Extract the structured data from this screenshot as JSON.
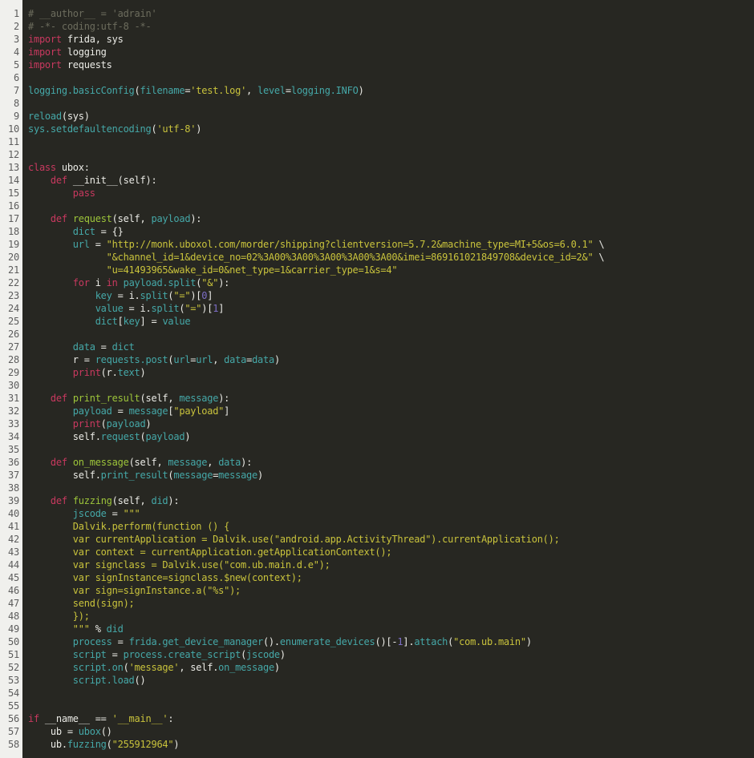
{
  "app": {
    "type": "code-viewer",
    "language": "python"
  },
  "colors": {
    "background": "#272722",
    "gutter_bg": "#f0f0ed",
    "gutter_text": "#5c5c5c",
    "default": "#ebebe6",
    "comment": "#6c6c5d",
    "keyword": "#c8395f",
    "string": "#c9c33c",
    "name": "#45a8a8",
    "function": "#9dc53a",
    "number": "#7d6ec6"
  },
  "editor": {
    "line_count": 58,
    "lines": [
      {
        "n": 1,
        "seg": [
          [
            "c",
            "# __author__ = 'adrain'"
          ]
        ]
      },
      {
        "n": 2,
        "seg": [
          [
            "c",
            "# -*- coding:utf-8 -*-"
          ]
        ]
      },
      {
        "n": 3,
        "seg": [
          [
            "k",
            "import"
          ],
          [
            "d",
            " frida, sys"
          ]
        ]
      },
      {
        "n": 4,
        "seg": [
          [
            "k",
            "import"
          ],
          [
            "d",
            " logging"
          ]
        ]
      },
      {
        "n": 5,
        "seg": [
          [
            "k",
            "import"
          ],
          [
            "d",
            " requests"
          ]
        ]
      },
      {
        "n": 6,
        "seg": []
      },
      {
        "n": 7,
        "seg": [
          [
            "n",
            "logging.basicConfig"
          ],
          [
            "d",
            "("
          ],
          [
            "n",
            "filename"
          ],
          [
            "d",
            "="
          ],
          [
            "s",
            "'test.log'"
          ],
          [
            "d",
            ", "
          ],
          [
            "n",
            "level"
          ],
          [
            "d",
            "="
          ],
          [
            "n",
            "logging.INFO"
          ],
          [
            "d",
            ")"
          ]
        ]
      },
      {
        "n": 8,
        "seg": []
      },
      {
        "n": 9,
        "seg": [
          [
            "n",
            "reload"
          ],
          [
            "d",
            "(sys)"
          ]
        ]
      },
      {
        "n": 10,
        "seg": [
          [
            "n",
            "sys.setdefaultencoding"
          ],
          [
            "d",
            "("
          ],
          [
            "s",
            "'utf-8'"
          ],
          [
            "d",
            ")"
          ]
        ]
      },
      {
        "n": 11,
        "seg": []
      },
      {
        "n": 12,
        "seg": []
      },
      {
        "n": 13,
        "seg": [
          [
            "k",
            "class"
          ],
          [
            "d",
            " ubox:"
          ]
        ]
      },
      {
        "n": 14,
        "seg": [
          [
            "d",
            "    "
          ],
          [
            "k",
            "def"
          ],
          [
            "d",
            " __init__(self):"
          ]
        ]
      },
      {
        "n": 15,
        "seg": [
          [
            "d",
            "        "
          ],
          [
            "k",
            "pass"
          ]
        ]
      },
      {
        "n": 16,
        "seg": []
      },
      {
        "n": 17,
        "seg": [
          [
            "d",
            "    "
          ],
          [
            "k",
            "def"
          ],
          [
            "d",
            " "
          ],
          [
            "f",
            "request"
          ],
          [
            "d",
            "(self, "
          ],
          [
            "n",
            "payload"
          ],
          [
            "d",
            "):"
          ]
        ]
      },
      {
        "n": 18,
        "seg": [
          [
            "d",
            "        "
          ],
          [
            "n",
            "dict"
          ],
          [
            "d",
            " = {}"
          ]
        ]
      },
      {
        "n": 19,
        "seg": [
          [
            "d",
            "        "
          ],
          [
            "n",
            "url"
          ],
          [
            "d",
            " = "
          ],
          [
            "s",
            "\"http://monk.uboxol.com/morder/shipping?clientversion=5.7.2&machine_type=MI+5&os=6.0.1\""
          ],
          [
            "d",
            " \\"
          ]
        ]
      },
      {
        "n": 20,
        "seg": [
          [
            "d",
            "              "
          ],
          [
            "s",
            "\"&channel_id=1&device_no=02%3A00%3A00%3A00%3A00%3A00&imei=869161021849708&device_id=2&\""
          ],
          [
            "d",
            " \\"
          ]
        ]
      },
      {
        "n": 21,
        "seg": [
          [
            "d",
            "              "
          ],
          [
            "s",
            "\"u=41493965&wake_id=0&net_type=1&carrier_type=1&s=4\""
          ]
        ]
      },
      {
        "n": 22,
        "seg": [
          [
            "d",
            "        "
          ],
          [
            "k",
            "for"
          ],
          [
            "d",
            " i "
          ],
          [
            "k",
            "in"
          ],
          [
            "d",
            " "
          ],
          [
            "n",
            "payload.split"
          ],
          [
            "d",
            "("
          ],
          [
            "s",
            "\"&\""
          ],
          [
            "d",
            "):"
          ]
        ]
      },
      {
        "n": 23,
        "seg": [
          [
            "d",
            "            "
          ],
          [
            "n",
            "key"
          ],
          [
            "d",
            " = i."
          ],
          [
            "n",
            "split"
          ],
          [
            "d",
            "("
          ],
          [
            "s",
            "\"=\""
          ],
          [
            "d",
            ")["
          ],
          [
            "m",
            "0"
          ],
          [
            "d",
            "]"
          ]
        ]
      },
      {
        "n": 24,
        "seg": [
          [
            "d",
            "            "
          ],
          [
            "n",
            "value"
          ],
          [
            "d",
            " = i."
          ],
          [
            "n",
            "split"
          ],
          [
            "d",
            "("
          ],
          [
            "s",
            "\"=\""
          ],
          [
            "d",
            ")["
          ],
          [
            "m",
            "1"
          ],
          [
            "d",
            "]"
          ]
        ]
      },
      {
        "n": 25,
        "seg": [
          [
            "d",
            "            "
          ],
          [
            "n",
            "dict"
          ],
          [
            "d",
            "["
          ],
          [
            "n",
            "key"
          ],
          [
            "d",
            "] = "
          ],
          [
            "n",
            "value"
          ]
        ]
      },
      {
        "n": 26,
        "seg": []
      },
      {
        "n": 27,
        "seg": [
          [
            "d",
            "        "
          ],
          [
            "n",
            "data"
          ],
          [
            "d",
            " = "
          ],
          [
            "n",
            "dict"
          ]
        ]
      },
      {
        "n": 28,
        "seg": [
          [
            "d",
            "        r = "
          ],
          [
            "n",
            "requests.post"
          ],
          [
            "d",
            "("
          ],
          [
            "n",
            "url"
          ],
          [
            "d",
            "="
          ],
          [
            "n",
            "url"
          ],
          [
            "d",
            ", "
          ],
          [
            "n",
            "data"
          ],
          [
            "d",
            "="
          ],
          [
            "n",
            "data"
          ],
          [
            "d",
            ")"
          ]
        ]
      },
      {
        "n": 29,
        "seg": [
          [
            "d",
            "        "
          ],
          [
            "k",
            "print"
          ],
          [
            "d",
            "(r."
          ],
          [
            "n",
            "text"
          ],
          [
            "d",
            ")"
          ]
        ]
      },
      {
        "n": 30,
        "seg": []
      },
      {
        "n": 31,
        "seg": [
          [
            "d",
            "    "
          ],
          [
            "k",
            "def"
          ],
          [
            "d",
            " "
          ],
          [
            "f",
            "print_result"
          ],
          [
            "d",
            "(self, "
          ],
          [
            "n",
            "message"
          ],
          [
            "d",
            "):"
          ]
        ]
      },
      {
        "n": 32,
        "seg": [
          [
            "d",
            "        "
          ],
          [
            "n",
            "payload"
          ],
          [
            "d",
            " = "
          ],
          [
            "n",
            "message"
          ],
          [
            "d",
            "["
          ],
          [
            "s",
            "\"payload\""
          ],
          [
            "d",
            "]"
          ]
        ]
      },
      {
        "n": 33,
        "seg": [
          [
            "d",
            "        "
          ],
          [
            "k",
            "print"
          ],
          [
            "d",
            "("
          ],
          [
            "n",
            "payload"
          ],
          [
            "d",
            ")"
          ]
        ]
      },
      {
        "n": 34,
        "seg": [
          [
            "d",
            "        self."
          ],
          [
            "n",
            "request"
          ],
          [
            "d",
            "("
          ],
          [
            "n",
            "payload"
          ],
          [
            "d",
            ")"
          ]
        ]
      },
      {
        "n": 35,
        "seg": []
      },
      {
        "n": 36,
        "seg": [
          [
            "d",
            "    "
          ],
          [
            "k",
            "def"
          ],
          [
            "d",
            " "
          ],
          [
            "f",
            "on_message"
          ],
          [
            "d",
            "(self, "
          ],
          [
            "n",
            "message"
          ],
          [
            "d",
            ", "
          ],
          [
            "n",
            "data"
          ],
          [
            "d",
            "):"
          ]
        ]
      },
      {
        "n": 37,
        "seg": [
          [
            "d",
            "        self."
          ],
          [
            "n",
            "print_result"
          ],
          [
            "d",
            "("
          ],
          [
            "n",
            "message"
          ],
          [
            "d",
            "="
          ],
          [
            "n",
            "message"
          ],
          [
            "d",
            ")"
          ]
        ]
      },
      {
        "n": 38,
        "seg": []
      },
      {
        "n": 39,
        "seg": [
          [
            "d",
            "    "
          ],
          [
            "k",
            "def"
          ],
          [
            "d",
            " "
          ],
          [
            "f",
            "fuzzing"
          ],
          [
            "d",
            "(self, "
          ],
          [
            "n",
            "did"
          ],
          [
            "d",
            "):"
          ]
        ]
      },
      {
        "n": 40,
        "seg": [
          [
            "d",
            "        "
          ],
          [
            "n",
            "jscode"
          ],
          [
            "d",
            " = "
          ],
          [
            "s",
            "\"\"\""
          ]
        ]
      },
      {
        "n": 41,
        "seg": [
          [
            "s",
            "        Dalvik.perform(function () {"
          ]
        ]
      },
      {
        "n": 42,
        "seg": [
          [
            "s",
            "        var currentApplication = Dalvik.use(\"android.app.ActivityThread\").currentApplication();"
          ]
        ]
      },
      {
        "n": 43,
        "seg": [
          [
            "s",
            "        var context = currentApplication.getApplicationContext();"
          ]
        ]
      },
      {
        "n": 44,
        "seg": [
          [
            "s",
            "        var signclass = Dalvik.use(\"com.ub.main.d.e\");"
          ]
        ]
      },
      {
        "n": 45,
        "seg": [
          [
            "s",
            "        var signInstance=signclass.$new(context);"
          ]
        ]
      },
      {
        "n": 46,
        "seg": [
          [
            "s",
            "        var sign=signInstance.a(\"%s\");"
          ]
        ]
      },
      {
        "n": 47,
        "seg": [
          [
            "s",
            "        send(sign);"
          ]
        ]
      },
      {
        "n": 48,
        "seg": [
          [
            "s",
            "        });"
          ]
        ]
      },
      {
        "n": 49,
        "seg": [
          [
            "d",
            "        "
          ],
          [
            "s",
            "\"\"\""
          ],
          [
            "d",
            " % "
          ],
          [
            "n",
            "did"
          ]
        ]
      },
      {
        "n": 50,
        "seg": [
          [
            "d",
            "        "
          ],
          [
            "n",
            "process"
          ],
          [
            "d",
            " = "
          ],
          [
            "n",
            "frida.get_device_manager"
          ],
          [
            "d",
            "()."
          ],
          [
            "n",
            "enumerate_devices"
          ],
          [
            "d",
            "()[-"
          ],
          [
            "m",
            "1"
          ],
          [
            "d",
            "]."
          ],
          [
            "n",
            "attach"
          ],
          [
            "d",
            "("
          ],
          [
            "s",
            "\"com.ub.main\""
          ],
          [
            "d",
            ")"
          ]
        ]
      },
      {
        "n": 51,
        "seg": [
          [
            "d",
            "        "
          ],
          [
            "n",
            "script"
          ],
          [
            "d",
            " = "
          ],
          [
            "n",
            "process.create_script"
          ],
          [
            "d",
            "("
          ],
          [
            "n",
            "jscode"
          ],
          [
            "d",
            ")"
          ]
        ]
      },
      {
        "n": 52,
        "seg": [
          [
            "d",
            "        "
          ],
          [
            "n",
            "script.on"
          ],
          [
            "d",
            "("
          ],
          [
            "s",
            "'message'"
          ],
          [
            "d",
            ", self."
          ],
          [
            "n",
            "on_message"
          ],
          [
            "d",
            ")"
          ]
        ]
      },
      {
        "n": 53,
        "seg": [
          [
            "d",
            "        "
          ],
          [
            "n",
            "script.load"
          ],
          [
            "d",
            "()"
          ]
        ]
      },
      {
        "n": 54,
        "seg": []
      },
      {
        "n": 55,
        "seg": []
      },
      {
        "n": 56,
        "seg": [
          [
            "k",
            "if"
          ],
          [
            "d",
            " __name__ == "
          ],
          [
            "s",
            "'__main__'"
          ],
          [
            "d",
            ":"
          ]
        ]
      },
      {
        "n": 57,
        "seg": [
          [
            "d",
            "    ub = "
          ],
          [
            "n",
            "ubox"
          ],
          [
            "d",
            "()"
          ]
        ]
      },
      {
        "n": 58,
        "seg": [
          [
            "d",
            "    ub."
          ],
          [
            "n",
            "fuzzing"
          ],
          [
            "d",
            "("
          ],
          [
            "s",
            "\"255912964\""
          ],
          [
            "d",
            ")"
          ]
        ]
      }
    ]
  }
}
